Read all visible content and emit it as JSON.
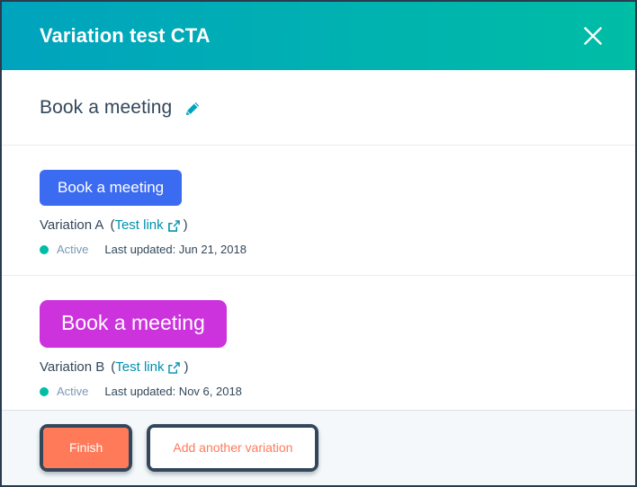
{
  "window": {
    "accent_teal": "#00A4BD",
    "accent_green": "#00BDA5",
    "accent_orange": "#FF7A59",
    "accent_navy": "#33475B"
  },
  "header": {
    "title": "Variation test CTA",
    "close_icon": "close-icon"
  },
  "cta": {
    "name": "Book a meeting",
    "edit_icon": "pencil-icon"
  },
  "variations": [
    {
      "preview_label": "Book a meeting",
      "preview_color": "#3B6BF0",
      "name": "Variation A",
      "paren_open": "(",
      "test_link_label": "Test link",
      "external_link_icon": "external-link-icon",
      "paren_close": ")",
      "status": "Active",
      "status_color": "#00BDA5",
      "last_updated": "Last updated: Jun 21, 2018"
    },
    {
      "preview_label": "Book a meeting",
      "preview_color": "#CC33DD",
      "name": "Variation B",
      "paren_open": "(",
      "test_link_label": "Test link",
      "external_link_icon": "external-link-icon",
      "paren_close": ")",
      "status": "Active",
      "status_color": "#00BDA5",
      "last_updated": "Last updated: Nov 6, 2018"
    }
  ],
  "footer": {
    "finish_label": "Finish",
    "add_variation_label": "Add another variation"
  }
}
